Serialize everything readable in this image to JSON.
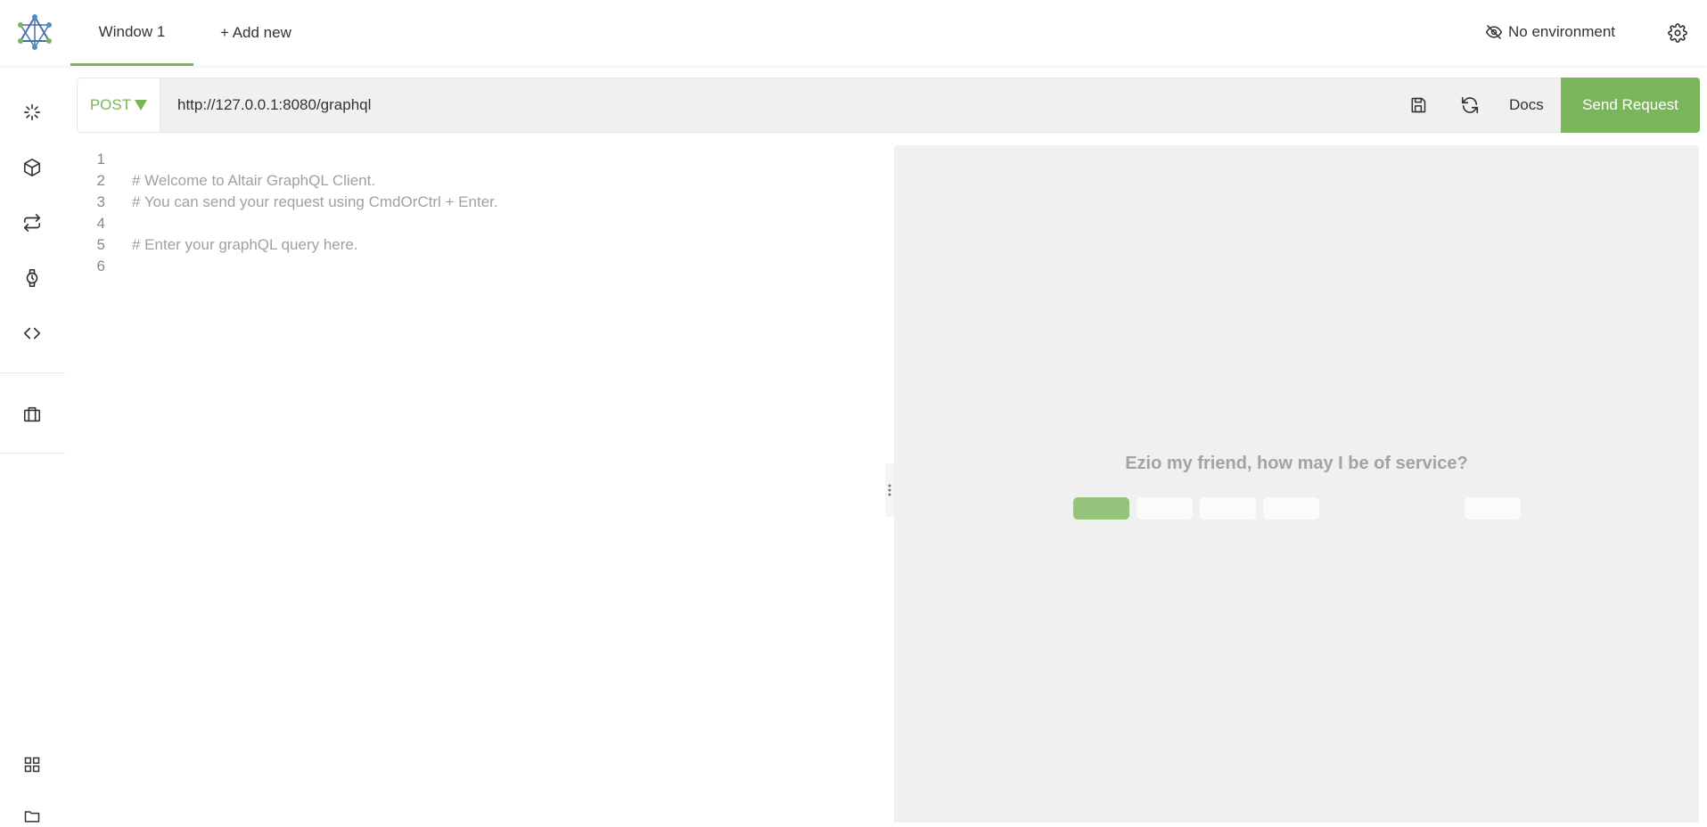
{
  "header": {
    "tabs": [
      {
        "label": "Window 1",
        "active": true
      },
      {
        "label": "+ Add new"
      }
    ],
    "environment_label": "No environment"
  },
  "request": {
    "method": "POST",
    "url": "http://127.0.0.1:8080/graphql",
    "docs_label": "Docs",
    "send_label": "Send Request"
  },
  "editor": {
    "lines": [
      {
        "n": "1",
        "text": ""
      },
      {
        "n": "2",
        "text": "# Welcome to Altair GraphQL Client."
      },
      {
        "n": "3",
        "text": "# You can send your request using CmdOrCtrl + Enter."
      },
      {
        "n": "4",
        "text": ""
      },
      {
        "n": "5",
        "text": "# Enter your graphQL query here."
      },
      {
        "n": "6",
        "text": ""
      }
    ]
  },
  "result": {
    "welcome": "Ezio my friend, how may I be of service?"
  },
  "sidebar": {
    "icons": [
      "loading-icon",
      "cube-icon",
      "switch-icon",
      "watch-icon",
      "code-icon",
      "briefcase-icon",
      "grid-icon",
      "folder-icon"
    ]
  },
  "colors": {
    "accent": "#7ab55c",
    "result_bg": "#f0f0f0"
  }
}
